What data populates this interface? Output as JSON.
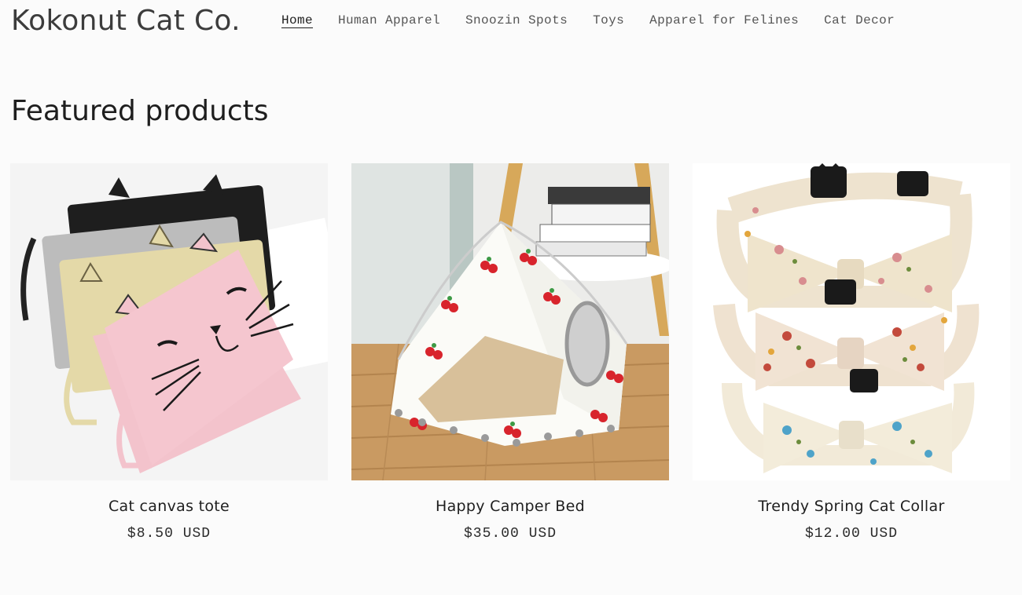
{
  "header": {
    "logo": "Kokonut Cat Co.",
    "nav": [
      {
        "label": "Home",
        "active": true
      },
      {
        "label": "Human Apparel",
        "active": false
      },
      {
        "label": "Snoozin Spots",
        "active": false
      },
      {
        "label": "Toys",
        "active": false
      },
      {
        "label": "Apparel for Felines",
        "active": false
      },
      {
        "label": "Cat Decor",
        "active": false
      }
    ]
  },
  "featured": {
    "title": "Featured products",
    "products": [
      {
        "name": "Cat canvas tote",
        "price": "$8.50 USD",
        "image": "cat-canvas-tote-photo"
      },
      {
        "name": "Happy Camper Bed",
        "price": "$35.00 USD",
        "image": "cat-tent-bed-photo"
      },
      {
        "name": "Trendy Spring Cat Collar",
        "price": "$12.00 USD",
        "image": "floral-bow-collars-photo"
      }
    ]
  },
  "theme": {
    "background": "#fbfbfb",
    "text": "#1e1e1e",
    "nav_text": "#555555"
  }
}
